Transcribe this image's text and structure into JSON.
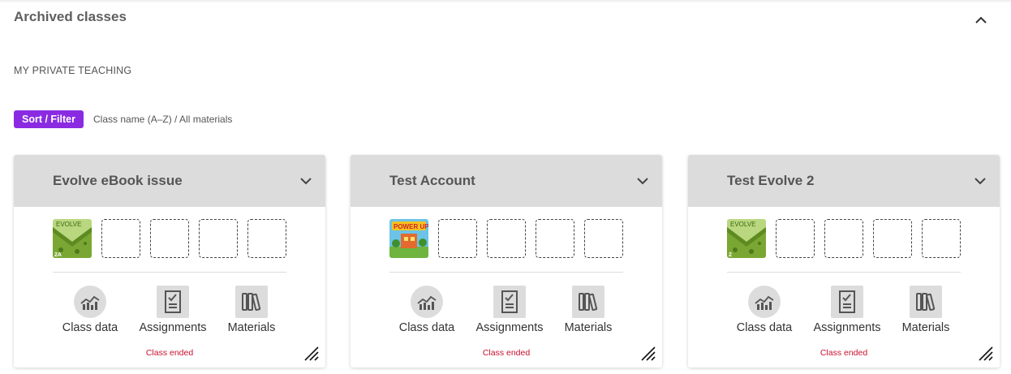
{
  "section": {
    "title": "Archived classes",
    "group_label": "MY PRIVATE TEACHING"
  },
  "sort": {
    "button_label": "Sort / Filter",
    "description": "Class name (A–Z) / All materials"
  },
  "colors": {
    "accent": "#8a2be2",
    "card_header": "#dcdcdc",
    "status": "#c8102e"
  },
  "classes": [
    {
      "title": "Evolve eBook issue",
      "book": {
        "brand": "EVOLVE",
        "level": "2A"
      },
      "actions": {
        "class_data": "Class data",
        "assignments": "Assignments",
        "materials": "Materials"
      },
      "status": "Class ended"
    },
    {
      "title": "Test Account",
      "book": {
        "brand": "POWER UP",
        "level": ""
      },
      "actions": {
        "class_data": "Class data",
        "assignments": "Assignments",
        "materials": "Materials"
      },
      "status": "Class ended"
    },
    {
      "title": "Test Evolve 2",
      "book": {
        "brand": "EVOLVE",
        "level": "2"
      },
      "actions": {
        "class_data": "Class data",
        "assignments": "Assignments",
        "materials": "Materials"
      },
      "status": "Class ended"
    }
  ]
}
